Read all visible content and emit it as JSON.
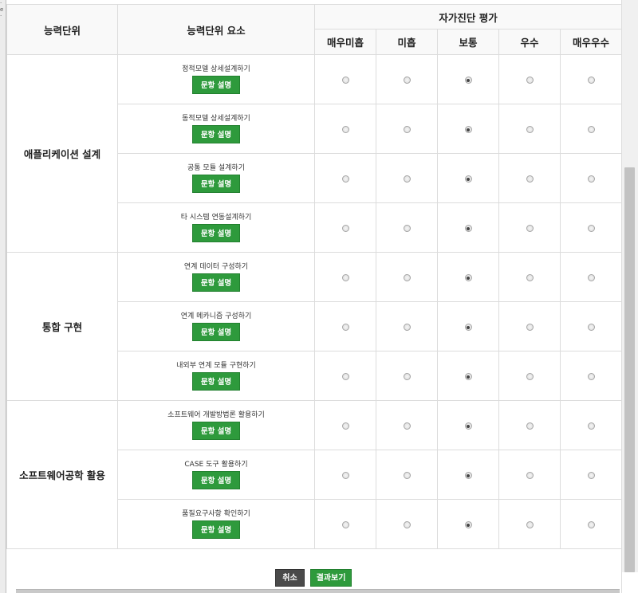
{
  "table": {
    "header": {
      "unit": "능력단위",
      "element": "능력단위 요소",
      "evaluation": "자가진단 평가"
    },
    "levels": [
      "매우미흡",
      "미흡",
      "보통",
      "우수",
      "매우우수"
    ],
    "button_label": "문항 설명",
    "groups": [
      {
        "unit": "애플리케이션 설계",
        "rows": [
          {
            "element": "정적모델 상세설계하기",
            "selected": 2
          },
          {
            "element": "동적모델 상세설계하기",
            "selected": 2
          },
          {
            "element": "공통 모듈 설계하기",
            "selected": 2
          },
          {
            "element": "타 시스템 연동설계하기",
            "selected": 2
          }
        ]
      },
      {
        "unit": "통합 구현",
        "rows": [
          {
            "element": "연계 데이터 구성하기",
            "selected": 2
          },
          {
            "element": "연계 메카니즘 구성하기",
            "selected": 2
          },
          {
            "element": "내외부 연계 모듈 구현하기",
            "selected": 2
          }
        ]
      },
      {
        "unit": "소프트웨어공학 활용",
        "rows": [
          {
            "element": "소프트웨어 개발방법론 활용하기",
            "selected": 2
          },
          {
            "element": "CASE 도구 활용하기",
            "selected": 2
          },
          {
            "element": "품질요구사항 확인하기",
            "selected": 2
          }
        ]
      }
    ]
  },
  "footer": {
    "cancel_label": "취소",
    "result_label": "결과보기"
  },
  "colors": {
    "accent_green": "#2e9a3c",
    "cancel_dark": "#4a4a4a"
  }
}
